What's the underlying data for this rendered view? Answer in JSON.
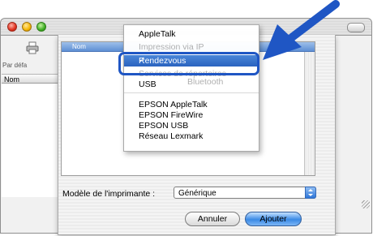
{
  "window": {
    "toolbar_label": "Par défa",
    "column_header": "Nom"
  },
  "sheet": {
    "list_header": "Nom",
    "model_label": "Modèle de l'imprimante :",
    "model_value": "Générique",
    "cancel_label": "Annuler",
    "add_label": "Ajouter"
  },
  "menu": {
    "items": [
      "AppleTalk",
      "Impression via IP",
      "Rendezvous",
      "Services de répertoires",
      "USB",
      "Bluetooth",
      "EPSON AppleTalk",
      "EPSON FireWire",
      "EPSON USB",
      "Réseau Lexmark"
    ],
    "selected_index": 2,
    "check": "✓"
  },
  "colors": {
    "accent": "#2a63bf",
    "callout": "#1f56c4"
  },
  "icons": [
    "printer-icon",
    "check-icon",
    "callout-arrow-icon",
    "resize-grip-icon"
  ]
}
